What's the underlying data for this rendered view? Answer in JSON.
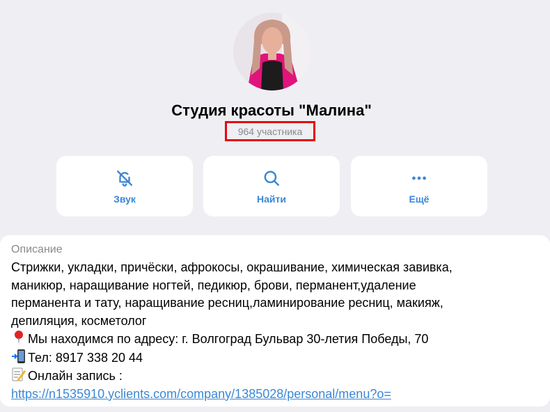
{
  "channel": {
    "title": "Студия красоты \"Малина\"",
    "members": "964 участника"
  },
  "actions": [
    {
      "label": "Звук",
      "icon": "bell-off-icon"
    },
    {
      "label": "Найти",
      "icon": "search-icon"
    },
    {
      "label": "Ещё",
      "icon": "more-horizontal-icon"
    }
  ],
  "description": {
    "heading": "Описание",
    "lines": [
      "Стрижки, укладки, причёски, афрокосы, окрашивание, химическая завивка,",
      "маникюр, наращивание ногтей, педикюр, брови, перманент,удаление",
      "перманента и тату, наращивание ресниц,ламинирование ресниц, макияж,",
      "депиляция, косметолог"
    ],
    "address": "Мы находимся по адресу: г. Волгоград Бульвар 30-летия Победы, 70",
    "phone": "Тел: 8917 338 20 44",
    "booking": "Онлайн запись :",
    "link": "https://n1535910.yclients.com/company/1385028/personal/menu?o="
  },
  "colors": {
    "background": "#efeff3",
    "accent": "#3b87d6",
    "highlight": "#e8000f",
    "muted": "#8a8a8e"
  }
}
